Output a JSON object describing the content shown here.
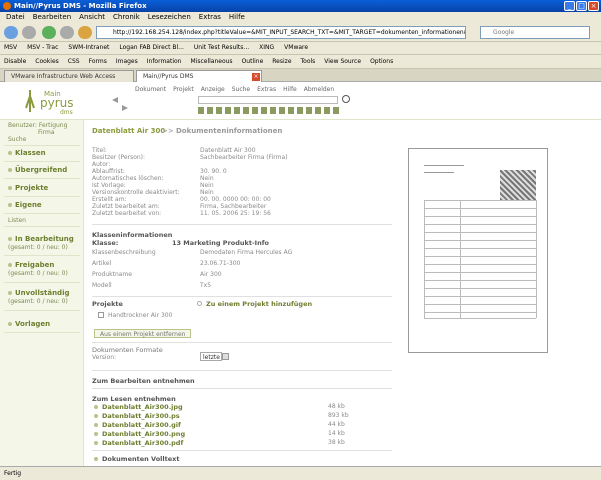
{
  "window": {
    "title": "Main//Pyrus DMS - Mozilla Firefox"
  },
  "menubar": [
    "Datei",
    "Bearbeiten",
    "Ansicht",
    "Chronik",
    "Lesezeichen",
    "Extras",
    "Hilfe"
  ],
  "navigation": {
    "url": "http://192.168.254.128/index.php?titleValue=&MIT_INPUT_SEARCH_TXT=&MIT_TARGET=dokumenten_informationen&MIT_FR",
    "search_placeholder": "Google"
  },
  "bookmarks": [
    "MSV",
    "MSV - Trac",
    "SWM-Intranet",
    "Logan FAB Direct Bl...",
    "Unit Test Results...",
    "XING",
    "VMware"
  ],
  "devtoolbar": [
    "Disable",
    "Cookies",
    "CSS",
    "Forms",
    "Images",
    "Information",
    "Miscellaneous",
    "Outline",
    "Resize",
    "Tools",
    "View Source",
    "Options"
  ],
  "tabs": [
    {
      "label": "VMware Infrastructure Web Access",
      "active": false
    },
    {
      "label": "Main//Pyrus DMS",
      "active": true
    }
  ],
  "app": {
    "logo_top": "Main",
    "logo_main": "pyrus",
    "logo_sub": "dms",
    "menu": [
      "Dokument",
      "Projekt",
      "Anzeige",
      "Suche",
      "Extras",
      "Hilfe",
      "Abmelden"
    ]
  },
  "sidebar": {
    "user_label": "Benutzer: Fertigung",
    "user_name": "Firma",
    "search_label": "Suche",
    "search_items": [
      "Klassen",
      "Übergreifend",
      "Projekte",
      "Eigene"
    ],
    "lists_label": "Listen",
    "list_items": [
      {
        "name": "In Bearbeitung",
        "count": "(gesamt: 0 / neu: 0)"
      },
      {
        "name": "Freigaben",
        "count": "(gesamt: 0 / neu: 0)"
      },
      {
        "name": "Unvollständig",
        "count": "(gesamt: 0 / neu: 0)"
      },
      {
        "name": "Vorlagen",
        "count": ""
      }
    ]
  },
  "breadcrumb": {
    "doc": "Datenblatt Air 300",
    "sep": ">>",
    "page": "Dokumenteninformationen"
  },
  "info": {
    "rows": [
      {
        "label": "Titel:",
        "value": "Datenblatt Air 300"
      },
      {
        "label": "Besitzer (Person):",
        "value": "Sachbearbeiter Firma (Firma)"
      },
      {
        "label": "Autor:",
        "value": ""
      },
      {
        "label": "Ablauffrist:",
        "value": "30. 90. 0"
      },
      {
        "label": "Automatisches löschen:",
        "value": "Nein"
      },
      {
        "label": "Ist Vorlage:",
        "value": "Nein"
      },
      {
        "label": "Versionskontrolle deaktiviert:",
        "value": "Nein"
      },
      {
        "label": "Erstellt am:",
        "value": "00. 00. 0000 00: 00: 00"
      },
      {
        "label": "Zuletzt bearbeitet am:",
        "value": "Firma, Sachbearbeiter"
      },
      {
        "label": "Zuletzt bearbeitet von:",
        "value": "11. 05. 2006 25: 19: 56"
      }
    ]
  },
  "classinfo": {
    "title": "Klasseninformationen",
    "class_label": "Klasse:",
    "class_value": "13 Marketing Produkt-Info",
    "rows": [
      {
        "label": "Klassenbeschreibung",
        "value": "Demodaten Firma Hercules AG"
      },
      {
        "label": "Artikel",
        "value": "23.06.71-300"
      },
      {
        "label": "Produktname",
        "value": "Air 300"
      },
      {
        "label": "Modell",
        "value": "Tx5"
      }
    ]
  },
  "projects": {
    "title": "Projekte",
    "add_link": "Zu einem Projekt hinzufügen",
    "checkbox_label": "Handtrockner Air 300",
    "remove_button": "Aus einem Projekt entfernen"
  },
  "formats": {
    "title": "Dokumenten Formate",
    "version_label": "Version:",
    "version_value": "letzte"
  },
  "edit": {
    "title": "Zum Bearbeiten entnehmen"
  },
  "read": {
    "title": "Zum Lesen entnehmen",
    "files": [
      {
        "name": "Datenblatt_Air300.jpg",
        "size": "48 kb"
      },
      {
        "name": "Datenblatt_Air300.ps",
        "size": "893 kb"
      },
      {
        "name": "Datenblatt_Air300.gif",
        "size": "44 kb"
      },
      {
        "name": "Datenblatt_Air300.png",
        "size": "14 kb"
      },
      {
        "name": "Datenblatt_Air300.pdf",
        "size": "38 kb"
      }
    ]
  },
  "fulltext": {
    "title": "Dokumenten Volltext"
  },
  "statusbar": {
    "text": "Fertig"
  }
}
